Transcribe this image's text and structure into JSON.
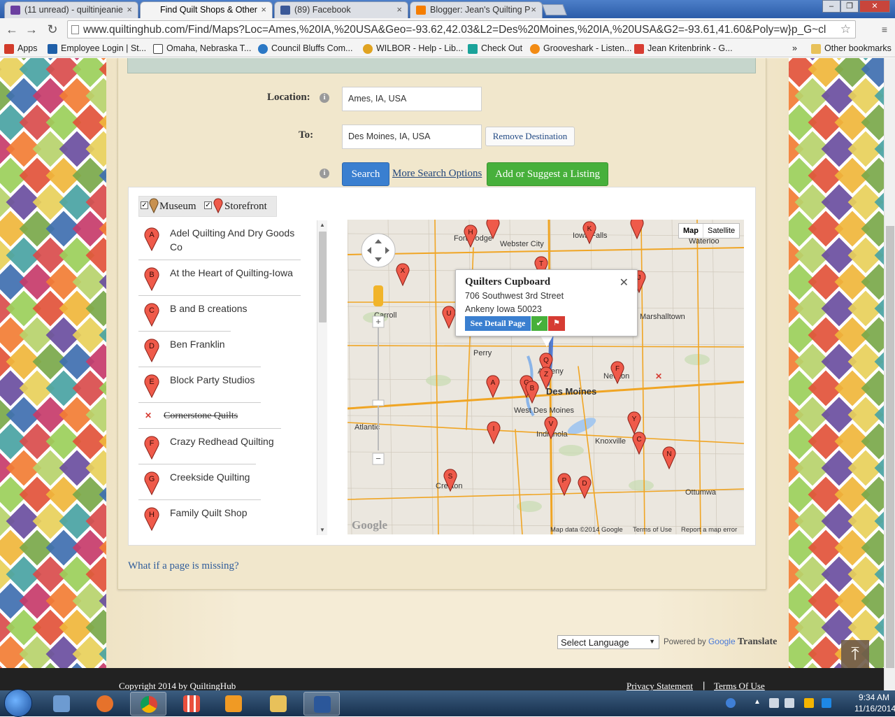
{
  "browser": {
    "tabs": [
      {
        "label": "(11 unread) - quiltinjeanie",
        "color": "#6b3fa0"
      },
      {
        "label": "Find Quilt Shops & Other",
        "color": "#3b8a3b"
      },
      {
        "label": "(89) Facebook",
        "color": "#3b5998"
      },
      {
        "label": "Blogger: Jean's Quilting P",
        "color": "#f57d00"
      }
    ],
    "url": "www.quiltinghub.com/Find/Maps?Loc=Ames,%20IA,%20USA&Geo=-93.62,42.03&L2=Des%20Moines,%20IA,%20USA&G2=-93.61,41.60&Poly=w}p_G~cl",
    "bookmarks": [
      {
        "label": "Apps",
        "color": "#d23b2b"
      },
      {
        "label": "Employee Login | St...",
        "color": "#1f5fa8"
      },
      {
        "label": "Omaha, Nebraska T...",
        "color": "#444"
      },
      {
        "label": "Council Bluffs Com...",
        "color": "#2b78c5"
      },
      {
        "label": "WILBOR - Help - Lib...",
        "color": "#e0a321"
      },
      {
        "label": "Check Out",
        "color": "#1aa39a"
      },
      {
        "label": "Grooveshark - Listen...",
        "color": "#f28b13"
      },
      {
        "label": "Jean Kritenbrink - G...",
        "color": "#d73d32"
      }
    ],
    "more_bookmarks": "»",
    "other_bookmarks": "Other bookmarks"
  },
  "form": {
    "location_label": "Location:",
    "location_value": "Ames, IA, USA",
    "to_label": "To:",
    "to_value": "Des Moines, IA, USA",
    "remove_destination": "Remove Destination",
    "search": "Search",
    "more_options": "More Search Options",
    "add_listing": "Add or Suggest a Listing"
  },
  "filters": {
    "museum": "Museum",
    "storefront": "Storefront"
  },
  "listings": [
    {
      "letter": "A",
      "name": "Adel Quilting And Dry Goods Co",
      "closed": false
    },
    {
      "letter": "B",
      "name": "At the Heart of Quilting-Iowa",
      "closed": false
    },
    {
      "letter": "C",
      "name": "B and B creations",
      "closed": false
    },
    {
      "letter": "D",
      "name": "Ben Franklin",
      "closed": false
    },
    {
      "letter": "E",
      "name": "Block Party Studios",
      "closed": false
    },
    {
      "letter": "",
      "name": "Cornerstone Quilts",
      "closed": true
    },
    {
      "letter": "F",
      "name": "Crazy Redhead Quilting",
      "closed": false
    },
    {
      "letter": "G",
      "name": "Creekside Quilting",
      "closed": false
    },
    {
      "letter": "H",
      "name": "Family Quilt Shop",
      "closed": false
    }
  ],
  "map": {
    "type_buttons": [
      "Map",
      "Satellite"
    ],
    "info_window": {
      "title": "Quilters Cupboard",
      "address1": "706 Southwest 3rd Street",
      "address2": "Ankeny Iowa 50023",
      "detail_button": "See Detail Page"
    },
    "cities": [
      "Fort Dodge",
      "Webster City",
      "Iowa Falls",
      "Waterloo",
      "Carroll",
      "Perry",
      "Ankeny",
      "Des Moines",
      "West Des Moines",
      "Atlantic",
      "Indianola",
      "Knoxville",
      "Newton",
      "Marshalltown",
      "Creston",
      "Ottumwa"
    ],
    "attribution": "Map data ©2014 Google",
    "terms": "Terms of Use",
    "report": "Report a map error",
    "google": "Google"
  },
  "missing_link": "What if a page is missing?",
  "translate": {
    "select": "Select Language",
    "powered": "Powered by",
    "google": "Google",
    "translate": "Translate"
  },
  "footer": {
    "copyright": "Copyright 2014 by QuiltingHub",
    "privacy": "Privacy Statement",
    "separator": "|",
    "terms": "Terms Of Use"
  },
  "taskbar": {
    "time": "9:34 AM",
    "date": "11/16/2014"
  }
}
